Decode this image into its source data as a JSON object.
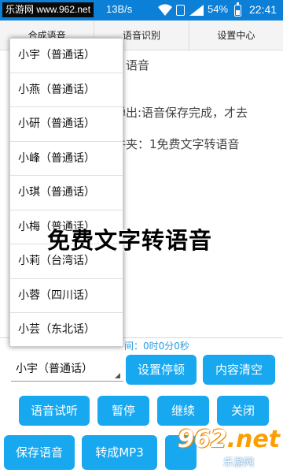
{
  "status_bar": {
    "watermark": "乐游网 www.962.net",
    "network_speed": "13B/s",
    "battery": "54%",
    "time": "22:41"
  },
  "tabs": [
    {
      "label": "合成语音"
    },
    {
      "label": "语音识别"
    },
    {
      "label": "设置中心"
    }
  ],
  "content": {
    "line1": "语音",
    "line2": "弹出:语音保存完成，才去",
    "line3": "件夹：1免费文字转语音"
  },
  "voice_options": [
    "小宇（普通话）",
    "小燕（普通话）",
    "小研（普通话）",
    "小峰（普通话）",
    "小琪（普通话）",
    "小梅（普通话）",
    "小莉（台湾话）",
    "小蓉（四川话）",
    "小芸（东北话）"
  ],
  "overlay_title": "免费文字转语音",
  "timer": "间：0时0分0秒",
  "selected_voice": "小宇（普通话）",
  "buttons": {
    "pause_settings": "设置停顿",
    "clear_content": "内容清空",
    "preview": "语音试听",
    "pause": "暂停",
    "resume": "继续",
    "close": "关闭",
    "save_voice": "保存语音",
    "to_mp3": "转成MP3"
  },
  "logo": {
    "number": "962",
    "suffix": ".net",
    "site_name": "乐游网"
  },
  "colors": {
    "status_bar": "#0c7fd6",
    "button": "#17a8f0",
    "timer": "#2a9be0"
  }
}
